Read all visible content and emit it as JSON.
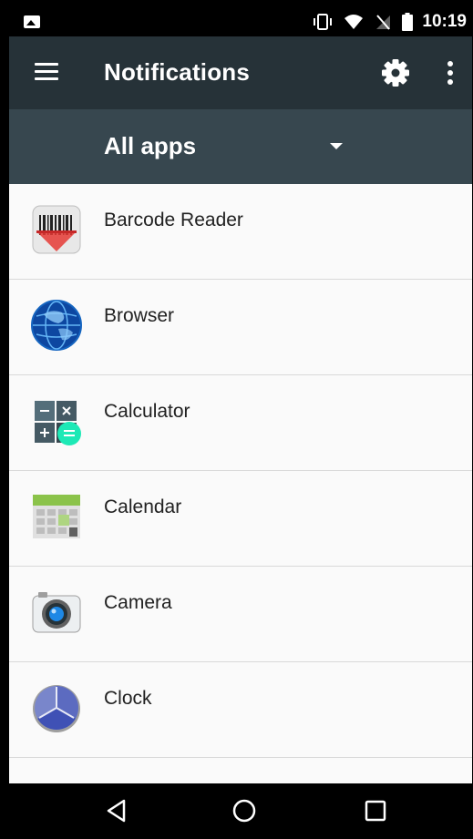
{
  "status_bar": {
    "time": "10:19",
    "icons": [
      "image-icon",
      "vibrate-icon",
      "wifi-icon",
      "no-sim-icon",
      "battery-icon"
    ]
  },
  "app_bar": {
    "title": "Notifications",
    "icons": [
      "menu-icon",
      "gear-icon",
      "more-vert-icon"
    ]
  },
  "filter": {
    "selected": "All apps"
  },
  "apps": [
    {
      "label": "Barcode Reader",
      "icon": "barcode-reader-icon"
    },
    {
      "label": "Browser",
      "icon": "browser-globe-icon"
    },
    {
      "label": "Calculator",
      "icon": "calculator-icon"
    },
    {
      "label": "Calendar",
      "icon": "calendar-icon"
    },
    {
      "label": "Camera",
      "icon": "camera-icon"
    },
    {
      "label": "Clock",
      "icon": "clock-icon"
    }
  ],
  "nav_bar": {
    "icons": [
      "back-icon",
      "home-icon",
      "recents-icon"
    ]
  },
  "colors": {
    "app_bar": "#263238",
    "filter_bar": "#37474f",
    "list_background": "#fafafa",
    "divider": "#d9d9d9"
  }
}
